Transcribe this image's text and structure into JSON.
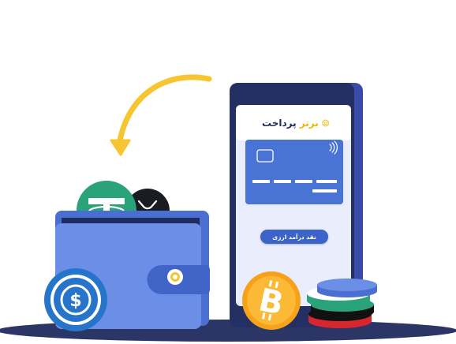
{
  "brand": {
    "name_part1": "برتر",
    "name_part2": "پرداخت",
    "logo_icon": "brand-logo-icon"
  },
  "phone": {
    "cta_label": "نقد درآمد ارزی"
  },
  "colors": {
    "phone_frame": "#243063",
    "card_blue": "#4a73d6",
    "wallet_blue": "#6b8fe6",
    "arrow_yellow": "#f7c531",
    "usdt_green": "#2aa37a",
    "btc_orange": "#f6a21b",
    "usdc_blue": "#2775ca",
    "shadow_navy": "#2b3566"
  },
  "icons": [
    "curved-arrow-icon",
    "tether-coin-icon",
    "ripple-coin-icon",
    "usdc-coin-icon",
    "bitcoin-coin-icon",
    "wallet-clasp-icon",
    "contactless-icon",
    "card-chip-icon"
  ]
}
